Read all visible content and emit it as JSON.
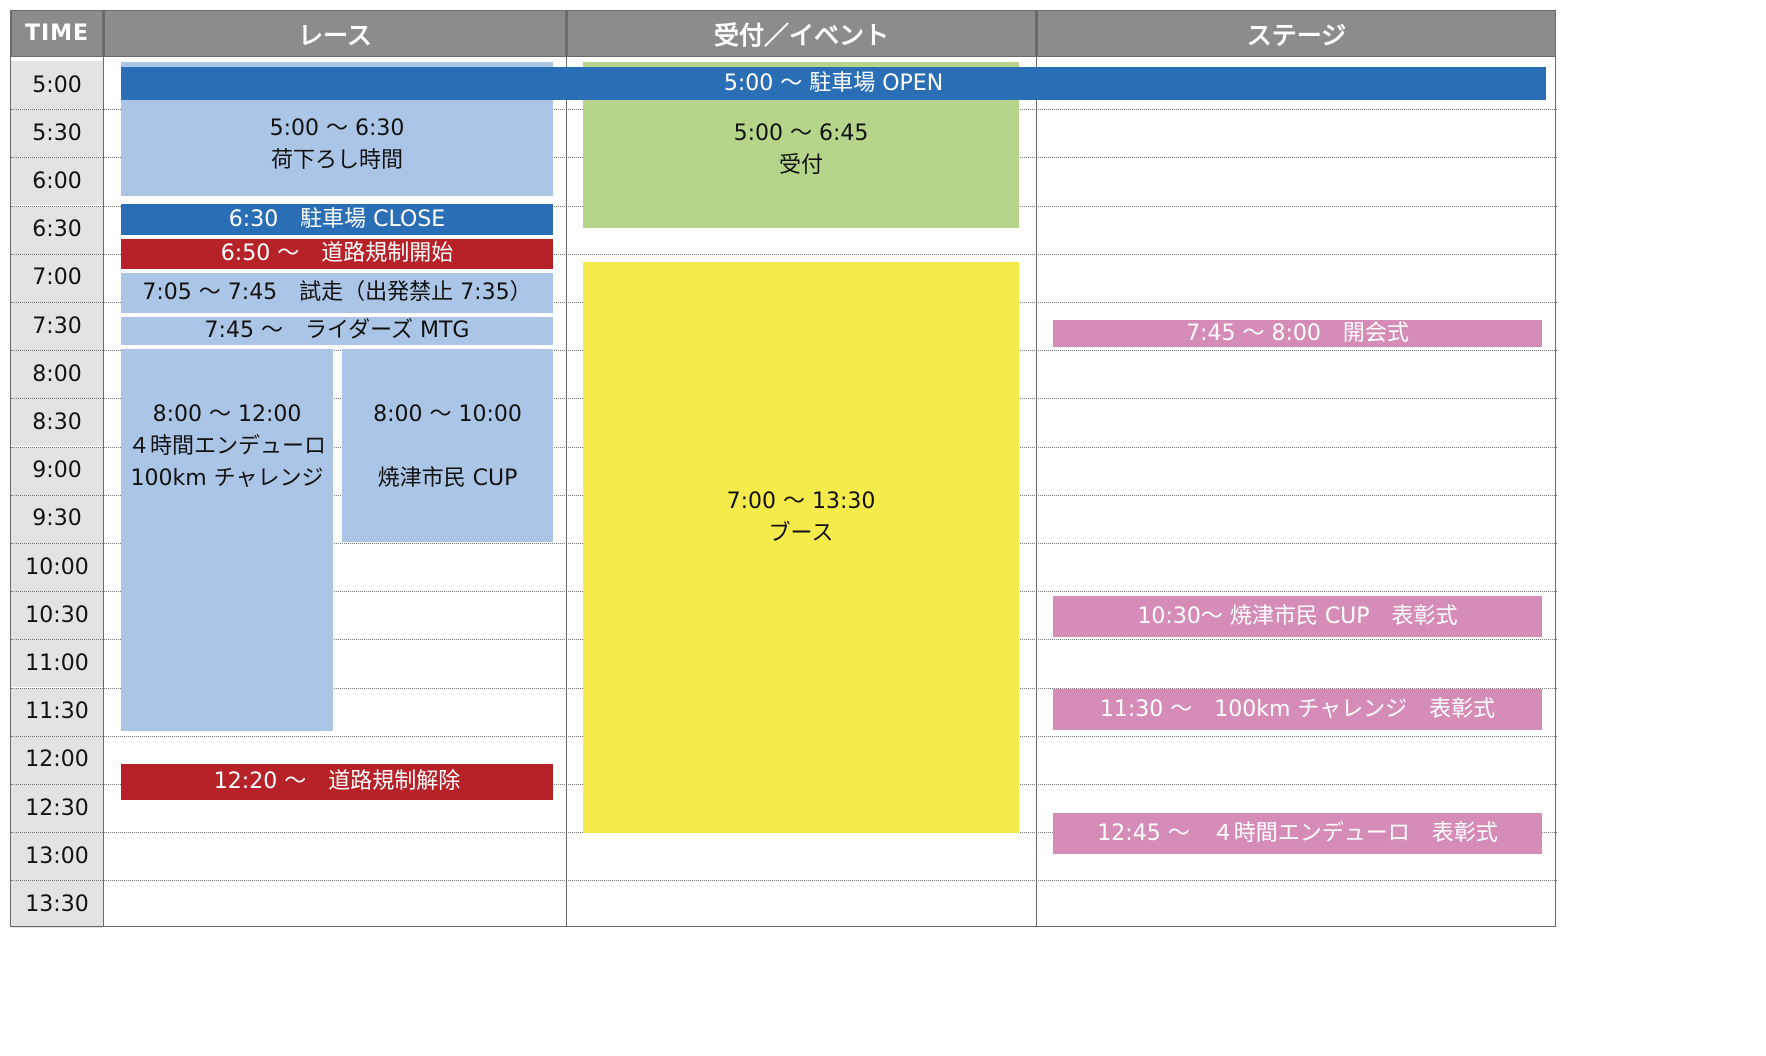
{
  "header": {
    "time_label": "TIME",
    "col_race": "レース",
    "col_reception": "受付／イベント",
    "col_stage": "ステージ"
  },
  "times": [
    "5:00",
    "5:30",
    "6:00",
    "6:30",
    "7:00",
    "7:30",
    "8:00",
    "8:30",
    "9:00",
    "9:30",
    "10:00",
    "10:30",
    "11:00",
    "11:30",
    "12:00",
    "12:30",
    "13:00",
    "13:30"
  ],
  "colors": {
    "header_bg": "#8c8c8c",
    "time_bg": "#e3e3e3",
    "dark_blue": "#2a6fb6",
    "light_blue": "#abc5e6",
    "red": "#b62227",
    "green": "#b7d58a",
    "yellow": "#f5ec4b",
    "pink": "#d58cb6"
  },
  "events": [
    {
      "id": "parking-open",
      "text": "5:00 ～ 駐車場 OPEN",
      "color": "#2a6fb6",
      "dark": true
    },
    {
      "id": "unloading",
      "text": "5:00 ～ 6:30\n荷下ろし時間",
      "color": "#abc5e6",
      "dark": false
    },
    {
      "id": "reception",
      "text": "5:00 ～ 6:45\n受付",
      "color": "#b7d58a",
      "dark": false
    },
    {
      "id": "parking-close",
      "text": "6:30　駐車場 CLOSE",
      "color": "#2a6fb6",
      "dark": true
    },
    {
      "id": "road-closure-start",
      "text": "6:50 ～　道路規制開始",
      "color": "#b62227",
      "dark": true
    },
    {
      "id": "test-run",
      "text": "7:05 ～ 7:45　試走（出発禁止 7:35）",
      "color": "#abc5e6",
      "dark": false
    },
    {
      "id": "riders-mtg",
      "text": "7:45 ～　ライダーズ MTG",
      "color": "#abc5e6",
      "dark": false
    },
    {
      "id": "enduro",
      "text": "8:00 ～ 12:00\n４時間エンデューロ\n100km チャレンジ",
      "color": "#abc5e6",
      "dark": false
    },
    {
      "id": "yaizu-cup",
      "text": "8:00 ～ 10:00\n\n焼津市民 CUP",
      "color": "#abc5e6",
      "dark": false
    },
    {
      "id": "booth",
      "text": "7:00 ～ 13:30\nブース",
      "color": "#f5ec4b",
      "dark": false
    },
    {
      "id": "opening-ceremony",
      "text": "7:45 ～ 8:00　開会式",
      "color": "#d58cb6",
      "dark": true
    },
    {
      "id": "cup-award",
      "text": "10:30～ 焼津市民 CUP　表彰式",
      "color": "#d58cb6",
      "dark": true
    },
    {
      "id": "challenge-award",
      "text": "11:30 ～　100km チャレンジ　表彰式",
      "color": "#d58cb6",
      "dark": true
    },
    {
      "id": "road-closure-end",
      "text": "12:20 ～　道路規制解除",
      "color": "#b62227",
      "dark": true
    },
    {
      "id": "enduro-award",
      "text": "12:45 ～　４時間エンデューロ　表彰式",
      "color": "#d58cb6",
      "dark": true
    }
  ]
}
